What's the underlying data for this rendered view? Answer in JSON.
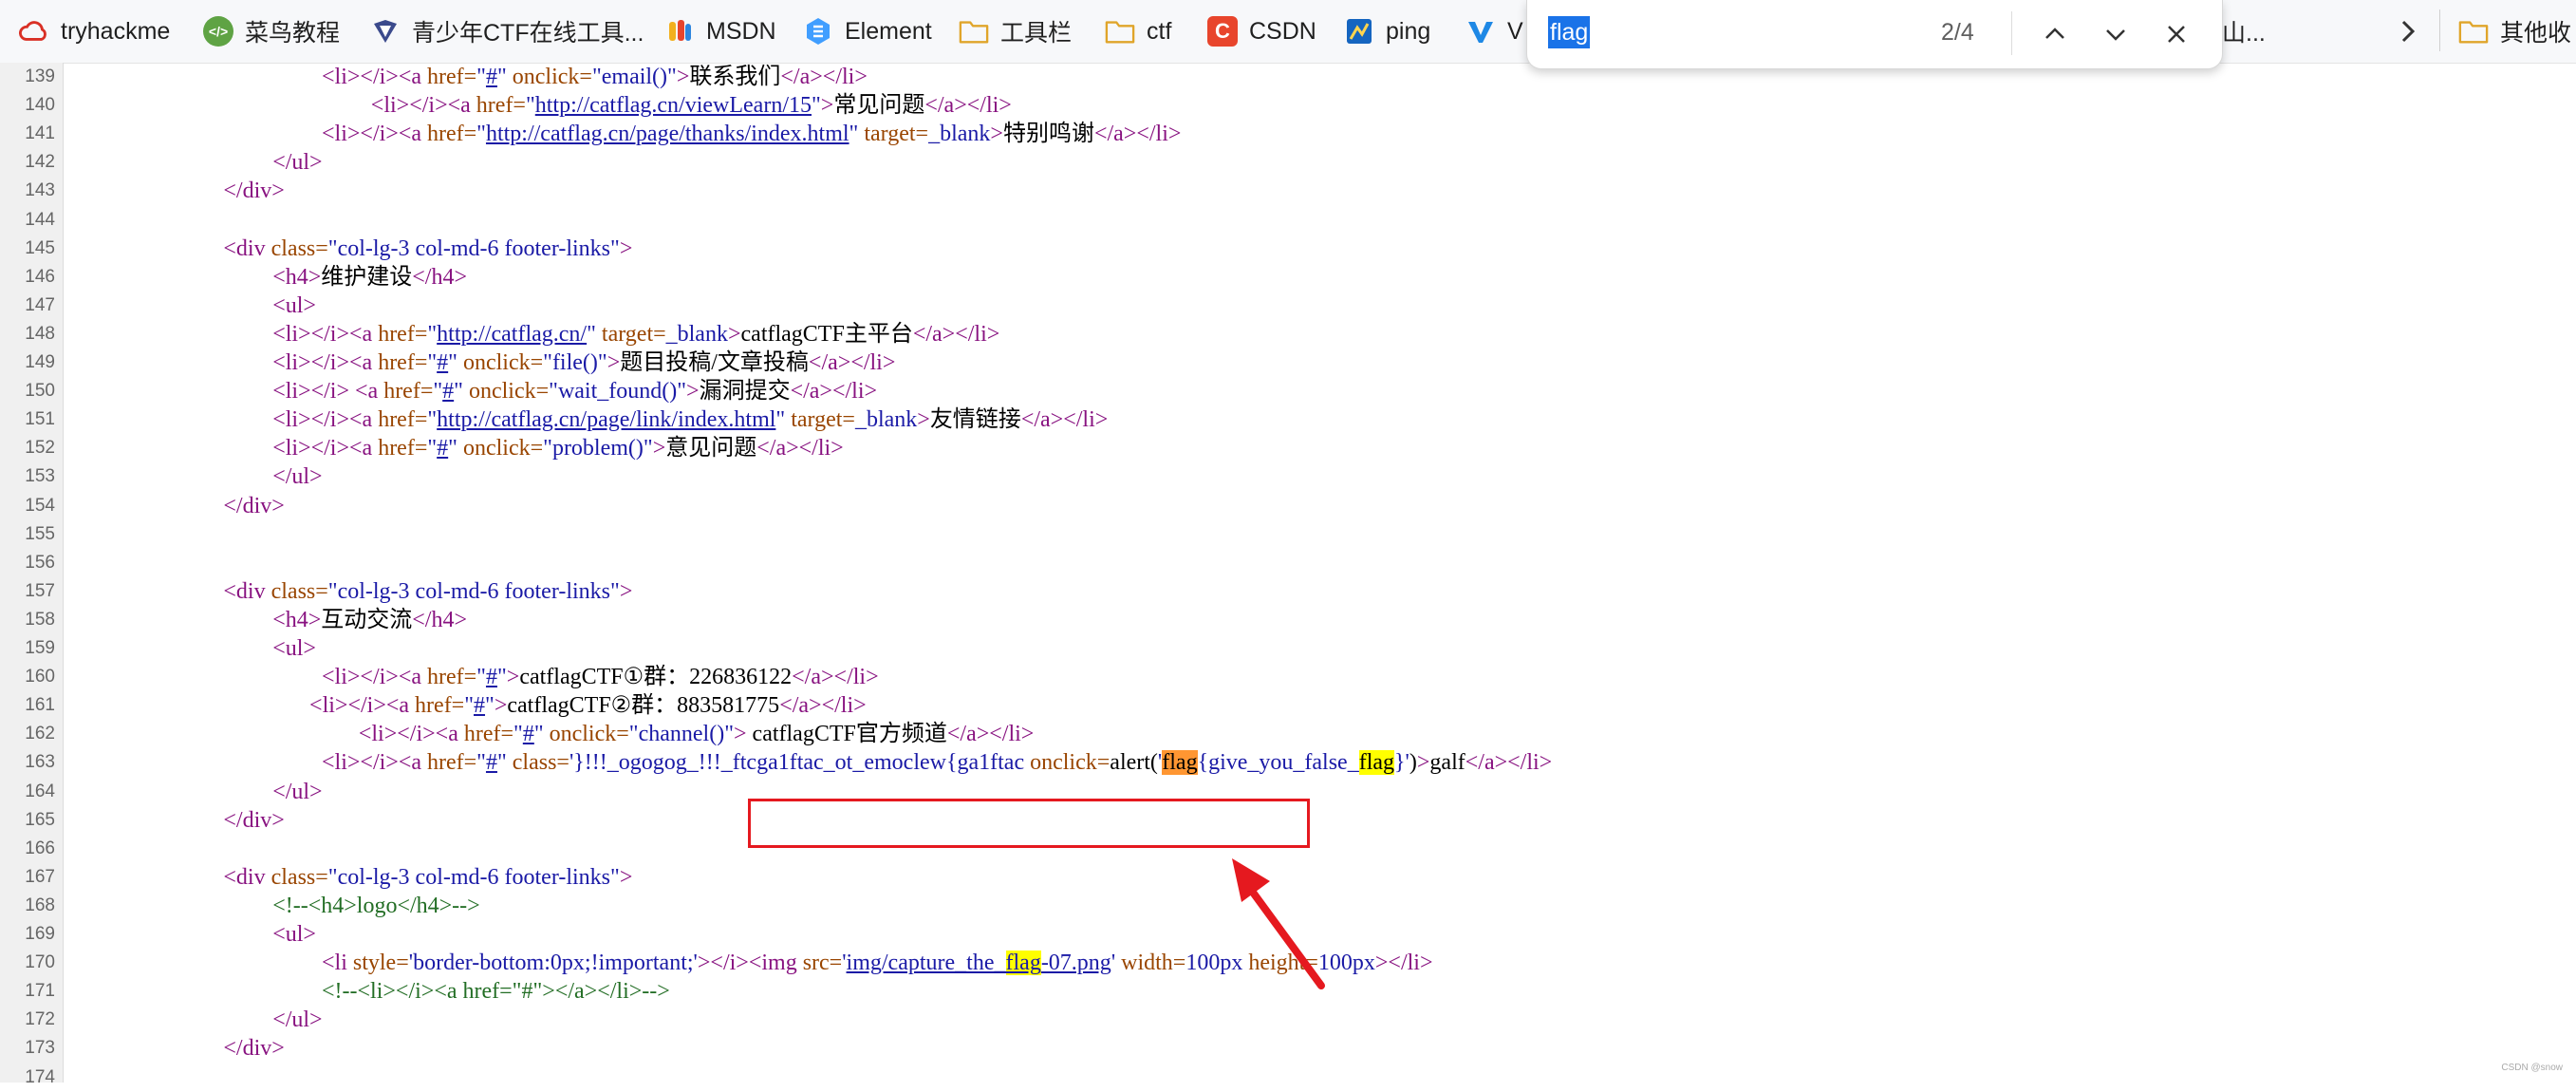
{
  "bookmarks": [
    {
      "label": "tryhackme",
      "icon": "cloud-icon"
    },
    {
      "label": "菜鸟教程",
      "icon": "runoob-icon"
    },
    {
      "label": "青少年CTF在线工具...",
      "icon": "ctf-icon"
    },
    {
      "label": "MSDN",
      "icon": "msdn-icon"
    },
    {
      "label": "Element",
      "icon": "element-icon"
    },
    {
      "label": "工具栏",
      "icon": "folder-icon"
    },
    {
      "label": "ctf",
      "icon": "folder-icon"
    },
    {
      "label": "CSDN",
      "icon": "csdn-icon"
    },
    {
      "label": "ping",
      "icon": "ping-icon"
    },
    {
      "label": "V",
      "icon": "v-icon"
    },
    {
      "label": "路山...",
      "icon": ""
    },
    {
      "label": "其他收",
      "icon": "folder-icon"
    }
  ],
  "find_bar": {
    "query": "flag",
    "count": "2/4"
  },
  "code_lines": [
    {
      "n": "139",
      "indent": 10,
      "html": "<span class='t'>&lt;li&gt;&lt;/i&gt;&lt;a </span><span class='a'>href=</span><span class='v'>\"<span class='u'>#</span>\"</span><span class='a'> onclick=</span><span class='v'>\"email()\"</span><span class='t'>&gt;</span>联系我们<span class='t'>&lt;/a&gt;&lt;/li&gt;</span>"
    },
    {
      "n": "140",
      "indent": 12,
      "html": "<span class='t'>&lt;li&gt;&lt;/i&gt;&lt;a </span><span class='a'>href=</span><span class='v'>\"<span class='u'>http://catflag.cn/viewLearn/15</span>\"</span><span class='t'>&gt;</span>常见问题<span class='t'>&lt;/a&gt;&lt;/li&gt;</span>"
    },
    {
      "n": "141",
      "indent": 10,
      "html": "<span class='t'>&lt;li&gt;&lt;/i&gt;&lt;a </span><span class='a'>href=</span><span class='v'>\"<span class='u'>http://catflag.cn/page/thanks/index.html</span>\"</span><span class='a'> target=</span><span class='v'>_blank</span><span class='t'>&gt;</span>特别鸣谢<span class='t'>&lt;/a&gt;&lt;/li&gt;</span>"
    },
    {
      "n": "142",
      "indent": 8,
      "html": "<span class='t'>&lt;/ul&gt;</span>"
    },
    {
      "n": "143",
      "indent": 6,
      "html": "<span class='t'>&lt;/div&gt;</span>"
    },
    {
      "n": "144",
      "indent": 0,
      "html": ""
    },
    {
      "n": "145",
      "indent": 6,
      "html": "<span class='t'>&lt;div </span><span class='a'>class=</span><span class='v'>\"col-lg-3 col-md-6 footer-links\"</span><span class='t'>&gt;</span>"
    },
    {
      "n": "146",
      "indent": 8,
      "html": "<span class='t'>&lt;h4&gt;</span>维护建设<span class='t'>&lt;/h4&gt;</span>"
    },
    {
      "n": "147",
      "indent": 8,
      "html": "<span class='t'>&lt;ul&gt;</span>"
    },
    {
      "n": "148",
      "indent": 8,
      "html": "<span class='t'>&lt;li&gt;&lt;/i&gt;&lt;a </span><span class='a'>href=</span><span class='v'>\"<span class='u'>http://catflag.cn/</span>\"</span><span class='a'> target=</span><span class='v'>_blank</span><span class='t'>&gt;</span>catflagCTF主平台<span class='t'>&lt;/a&gt;&lt;/li&gt;</span>"
    },
    {
      "n": "149",
      "indent": 8,
      "html": "<span class='t'>&lt;li&gt;&lt;/i&gt;&lt;a </span><span class='a'>href=</span><span class='v'>\"<span class='u'>#</span>\"</span><span class='a'> onclick=</span><span class='v'>\"file()\"</span><span class='t'>&gt;</span>题目投稿/文章投稿<span class='t'>&lt;/a&gt;&lt;/li&gt;</span>"
    },
    {
      "n": "150",
      "indent": 8,
      "html": "<span class='t'>&lt;li&gt;&lt;/i&gt; &lt;a </span><span class='a'>href=</span><span class='v'>\"<span class='u'>#</span>\"</span><span class='a'> onclick=</span><span class='v'>\"wait_found()\"</span><span class='t'>&gt;</span>漏洞提交<span class='t'>&lt;/a&gt;&lt;/li&gt;</span>"
    },
    {
      "n": "151",
      "indent": 8,
      "html": "<span class='t'>&lt;li&gt;&lt;/i&gt;&lt;a </span><span class='a'>href=</span><span class='v'>\"<span class='u'>http://catflag.cn/page/link/index.html</span>\"</span><span class='a'> target=</span><span class='v'>_blank</span><span class='t'>&gt;</span>友情链接<span class='t'>&lt;/a&gt;&lt;/li&gt;</span>"
    },
    {
      "n": "152",
      "indent": 8,
      "html": "<span class='t'>&lt;li&gt;&lt;/i&gt;&lt;a </span><span class='a'>href=</span><span class='v'>\"<span class='u'>#</span>\"</span><span class='a'> onclick=</span><span class='v'>\"problem()\"</span><span class='t'>&gt;</span>意见问题<span class='t'>&lt;/a&gt;&lt;/li&gt;</span>"
    },
    {
      "n": "153",
      "indent": 8,
      "html": "<span class='t'>&lt;/ul&gt;</span>"
    },
    {
      "n": "154",
      "indent": 6,
      "html": "<span class='t'>&lt;/div&gt;</span>"
    },
    {
      "n": "155",
      "indent": 0,
      "html": ""
    },
    {
      "n": "156",
      "indent": 0,
      "html": ""
    },
    {
      "n": "157",
      "indent": 6,
      "html": "<span class='t'>&lt;div </span><span class='a'>class=</span><span class='v'>\"col-lg-3 col-md-6 footer-links\"</span><span class='t'>&gt;</span>"
    },
    {
      "n": "158",
      "indent": 8,
      "html": "<span class='t'>&lt;h4&gt;</span>互动交流<span class='t'>&lt;/h4&gt;</span>"
    },
    {
      "n": "159",
      "indent": 8,
      "html": "<span class='t'>&lt;ul&gt;</span>"
    },
    {
      "n": "160",
      "indent": 10,
      "html": "<span class='t'>&lt;li&gt;&lt;/i&gt;&lt;a </span><span class='a'>href=</span><span class='v'>\"<span class='u'>#</span>\"</span><span class='t'>&gt;</span>catflagCTF①群：226836122<span class='t'>&lt;/a&gt;&lt;/li&gt;</span>"
    },
    {
      "n": "161",
      "indent": 9.5,
      "html": "<span class='t'>&lt;li&gt;&lt;/i&gt;&lt;a </span><span class='a'>href=</span><span class='v'>\"<span class='u'>#</span>\"</span><span class='t'>&gt;</span>catflagCTF②群：883581775<span class='t'>&lt;/a&gt;&lt;/li&gt;</span>"
    },
    {
      "n": "162",
      "indent": 11.5,
      "html": "<span class='t'>&lt;li&gt;&lt;/i&gt;&lt;a </span><span class='a'>href=</span><span class='v'>\"<span class='u'>#</span>\"</span><span class='a'> onclick=</span><span class='v'>\"channel()\"</span><span class='t'>&gt;</span> catflagCTF官方频道<span class='t'>&lt;/a&gt;&lt;/li&gt;</span>"
    },
    {
      "n": "163",
      "indent": 10,
      "html": "<span class='t'>&lt;li&gt;&lt;/i&gt;&lt;a </span><span class='a'>href=</span><span class='v'>\"<span class='u'>#</span>\"</span><span class='a'> class=</span><span class='v'>'}!!!_ogogog_!!!_ftcga1ftac_ot_emoclew{ga1ftac</span><span class='a'> onclick=</span><span class='x'>alert(</span><span class='v'>'</span><span class='hl-cur'>flag</span><span class='v'>{give_you_false_</span><span class='hl'>flag</span><span class='v'>}'</span><span class='x'>)</span><span class='t'>&gt;</span>galf<span class='t'>&lt;/a&gt;&lt;/li&gt;</span>"
    },
    {
      "n": "164",
      "indent": 8,
      "html": "<span class='t'>&lt;/ul&gt;</span>"
    },
    {
      "n": "165",
      "indent": 6,
      "html": "<span class='t'>&lt;/div&gt;</span>"
    },
    {
      "n": "166",
      "indent": 0,
      "html": ""
    },
    {
      "n": "167",
      "indent": 6,
      "html": "<span class='t'>&lt;div </span><span class='a'>class=</span><span class='v'>\"col-lg-3 col-md-6 footer-links\"</span><span class='t'>&gt;</span>"
    },
    {
      "n": "168",
      "indent": 8,
      "html": "<span class='c'>&lt;!--&lt;h4&gt;logo&lt;/h4&gt;--&gt;</span>"
    },
    {
      "n": "169",
      "indent": 8,
      "html": "<span class='t'>&lt;ul&gt;</span>"
    },
    {
      "n": "170",
      "indent": 10,
      "html": "<span class='t'>&lt;li </span><span class='a'>style=</span><span class='v'>'border-bottom:0px;!important;'</span><span class='t'>&gt;&lt;/i&gt;&lt;img </span><span class='a'>src=</span><span class='v'>'<span class='u'>img/capture_the_<span class='hl'>flag</span>-07.png</span>'</span><span class='a'> width=</span><span class='v'>100px</span><span class='a'> height=</span><span class='v'>100px</span><span class='t'>&gt;&lt;/li&gt;</span>"
    },
    {
      "n": "171",
      "indent": 10,
      "html": "<span class='c'>&lt;!--&lt;li&gt;&lt;/i&gt;&lt;a href=\"#\"&gt;&lt;/a&gt;&lt;/li&gt;--&gt;</span>"
    },
    {
      "n": "172",
      "indent": 8,
      "html": "<span class='t'>&lt;/ul&gt;</span>"
    },
    {
      "n": "173",
      "indent": 6,
      "html": "<span class='t'>&lt;/div&gt;</span>"
    },
    {
      "n": "174",
      "indent": 0,
      "html": ""
    }
  ],
  "watermark": "CSDN @snow"
}
